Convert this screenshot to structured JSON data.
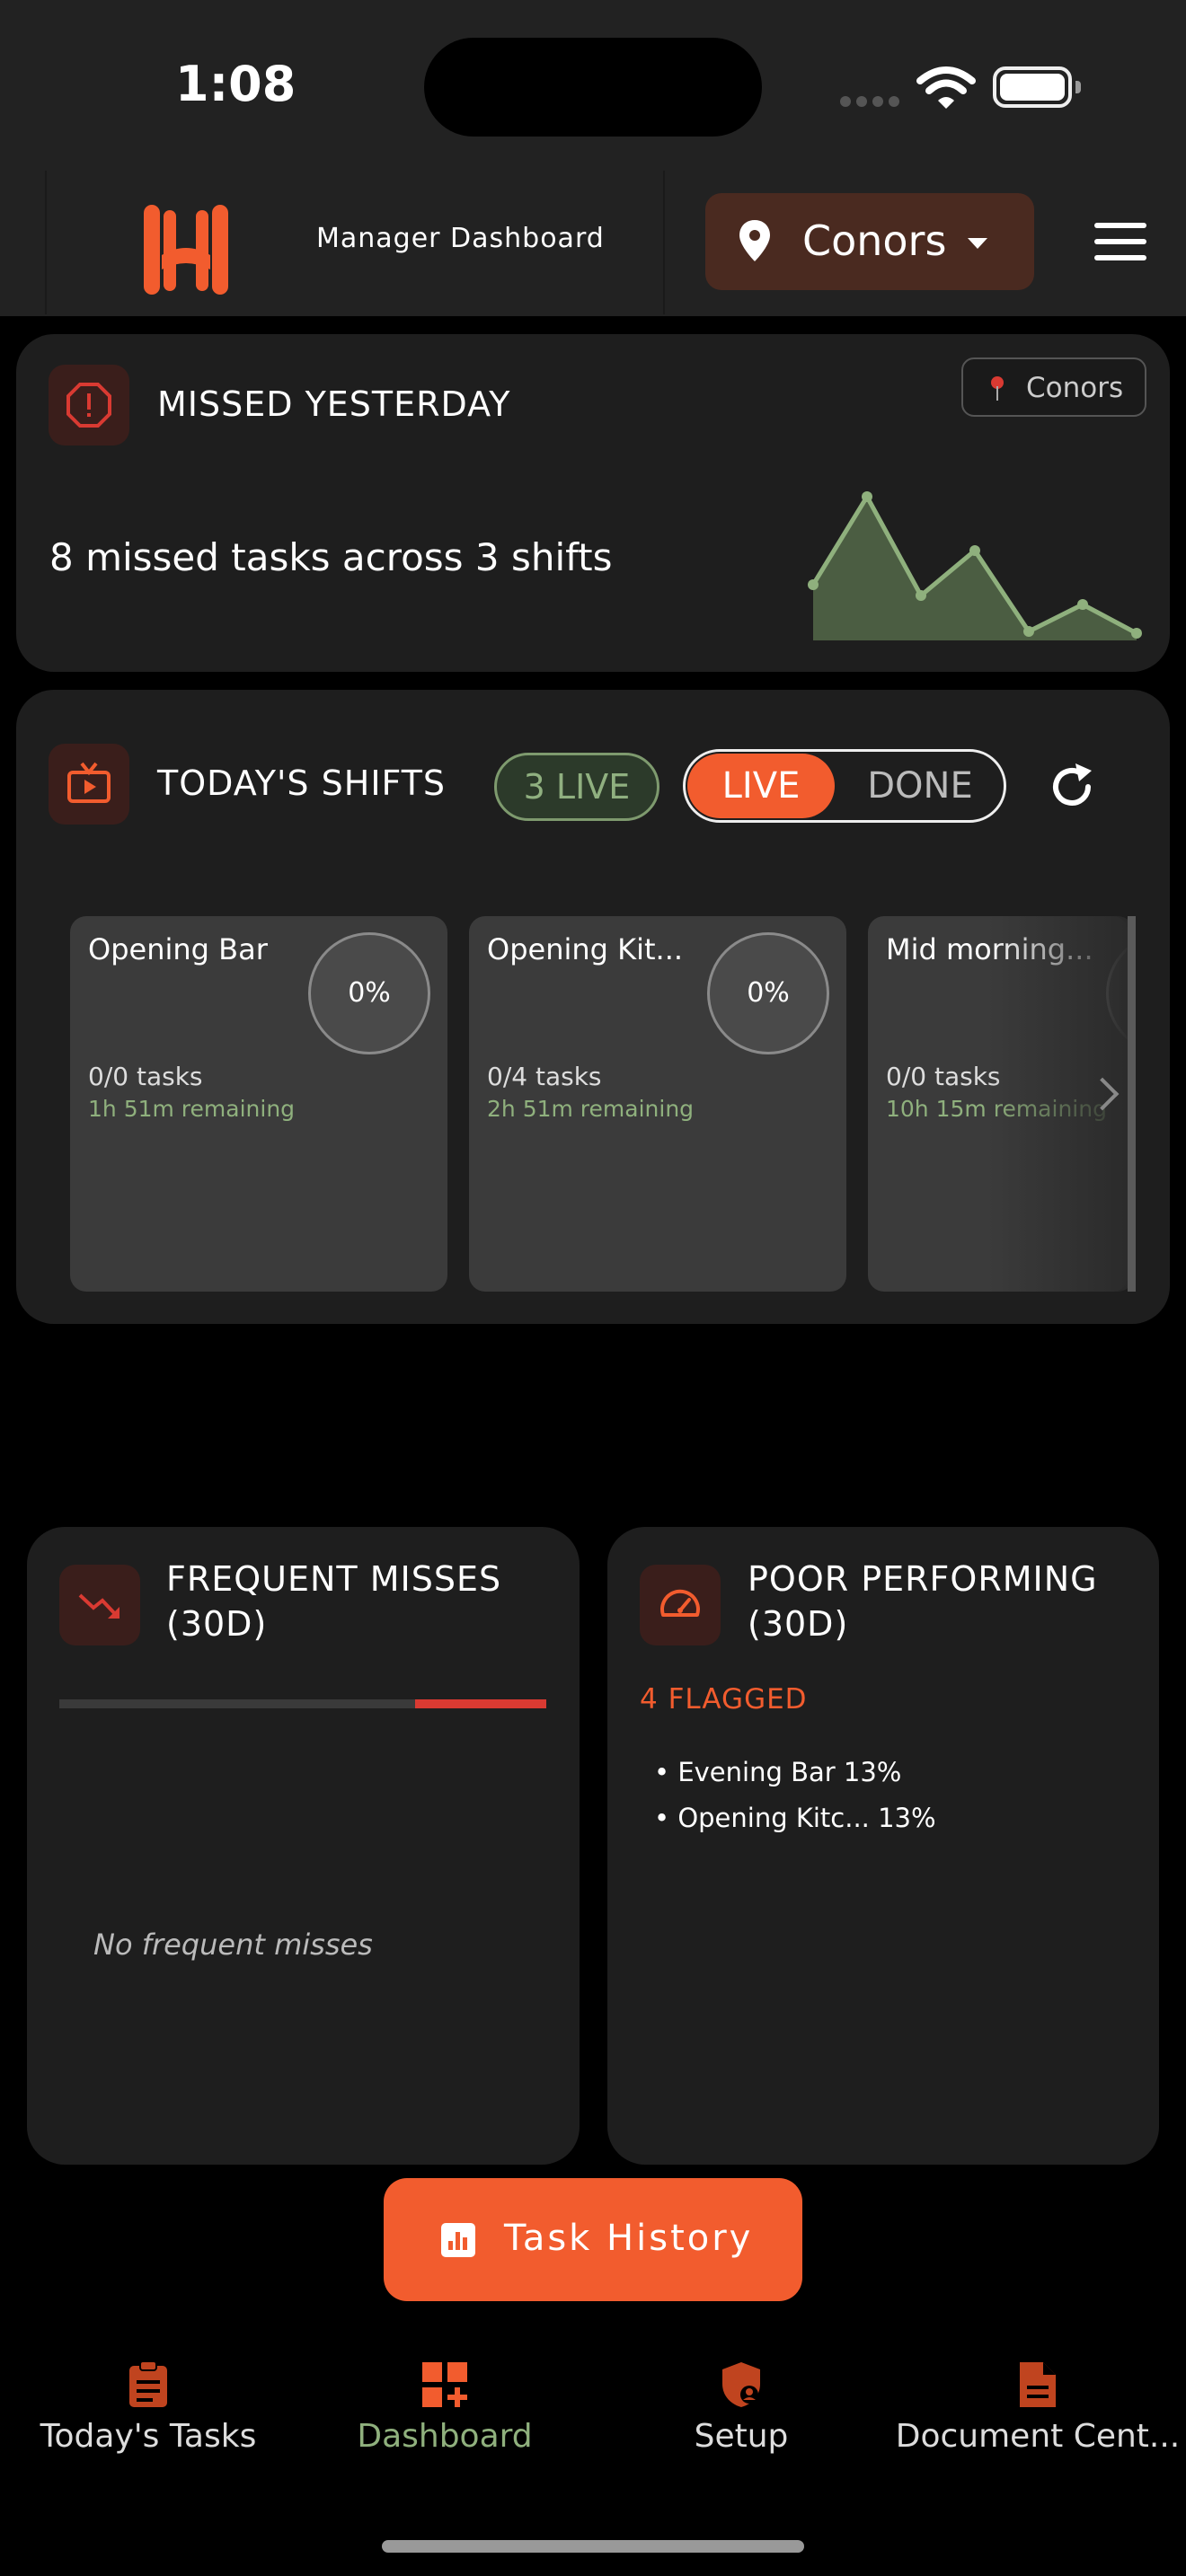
{
  "status_bar": {
    "time": "1:08"
  },
  "header": {
    "title": "Manager Dashboard",
    "location": "Conors"
  },
  "missed": {
    "title": "MISSED YESTERDAY",
    "location_chip": "Conors",
    "summary": "8 missed tasks across 3 shifts"
  },
  "shifts": {
    "title": "TODAY'S SHIFTS",
    "live_badge": "3 LIVE",
    "toggle_live": "LIVE",
    "toggle_done": "DONE",
    "items": [
      {
        "name": "Opening Bar",
        "percent": "0%",
        "tasks": "0/0 tasks",
        "remaining": "1h 51m remaining"
      },
      {
        "name": "Opening Kit...",
        "percent": "0%",
        "tasks": "0/4 tasks",
        "remaining": "2h 51m remaining"
      },
      {
        "name": "Mid morning...",
        "percent": "",
        "tasks": "0/0 tasks",
        "remaining": "10h 15m remaining"
      }
    ]
  },
  "frequent": {
    "title_line1": "FREQUENT MISSES",
    "title_line2": "(30D)",
    "empty": "No frequent misses"
  },
  "poor": {
    "title_line1": "POOR PERFORMING",
    "title_line2": "(30D)",
    "flagged": "4 FLAGGED",
    "items": [
      "• Evening Bar 13%",
      "• Opening Kitc... 13%"
    ]
  },
  "history_button": "Task History",
  "tabs": [
    {
      "label": "Today's Tasks",
      "active": false
    },
    {
      "label": "Dashboard",
      "active": true
    },
    {
      "label": "Setup",
      "active": false
    },
    {
      "label": "Document Cent...",
      "active": false
    }
  ],
  "colors": {
    "accent": "#f25c2e",
    "success": "#8fb07d",
    "danger": "#d93a32"
  }
}
